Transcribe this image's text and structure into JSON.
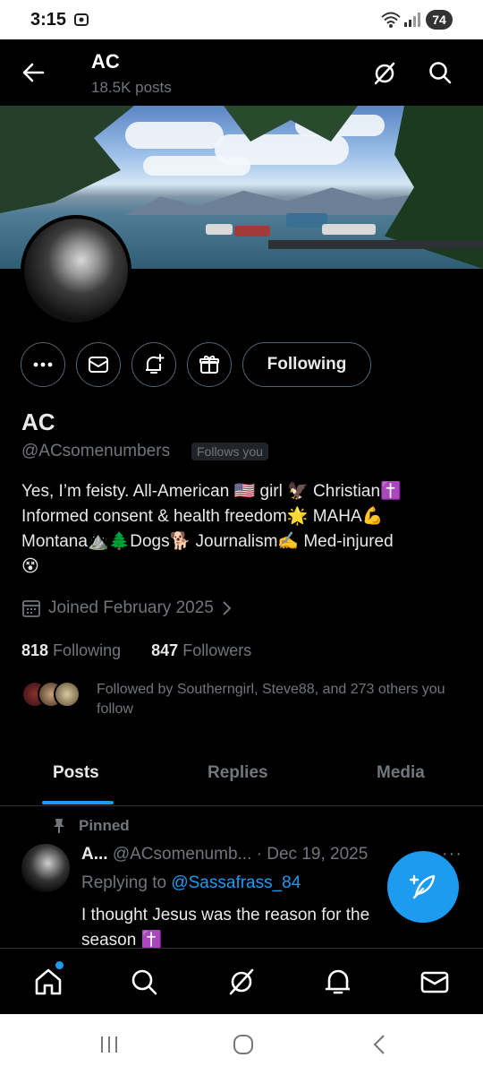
{
  "status_bar": {
    "time": "3:15",
    "battery": "74"
  },
  "header": {
    "title": "AC",
    "posts_count": "18.5K posts"
  },
  "profile": {
    "name": "AC",
    "handle": "@ACsomenumbers",
    "follows_you_badge": "Follows you",
    "bio_line1": "Yes, I’m feisty. All-American 🇺🇸 girl 🦅 Christian✝️",
    "bio_line2": "Informed consent & health freedom🌟 MAHA💪",
    "bio_line3": "Montana⛰️🌲Dogs🐕 Journalism✍️ Med-injured",
    "bio_line4": "😵",
    "joined": "Joined February 2025",
    "following_count": "818",
    "following_label": "Following",
    "followers_count": "847",
    "followers_label": "Followers",
    "followed_by": "Followed by Southerngirl, Steve88, and 273 others you follow",
    "follow_button": "Following"
  },
  "tabs": [
    {
      "label": "Posts",
      "active": true
    },
    {
      "label": "Replies",
      "active": false
    },
    {
      "label": "Media",
      "active": false
    }
  ],
  "pinned_post": {
    "pinned_label": "Pinned",
    "author": "A...",
    "handle": "@ACsomenumb...",
    "separator": "·",
    "date": "Dec 19, 2025",
    "replying_prefix": "Replying to",
    "replying_to": "@Sassafrass_84",
    "text_line1": "I thought Jesus was the reason for the",
    "text_line2": "season ✝️"
  },
  "bottom_nav": [
    "home-icon",
    "search-icon",
    "grok-icon",
    "notifications-icon",
    "messages-icon"
  ],
  "colors": {
    "accent": "#1d9bf0",
    "background": "#000000",
    "secondary_text": "#71767b"
  }
}
